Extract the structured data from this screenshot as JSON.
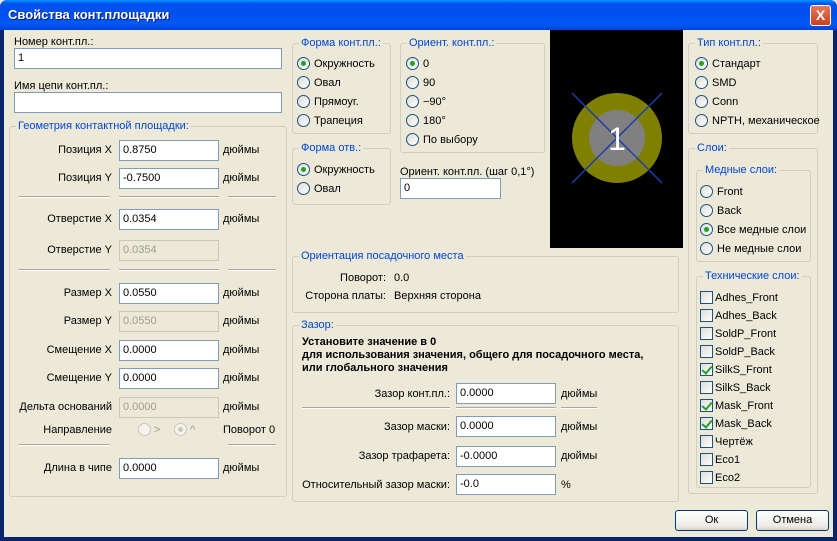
{
  "window": {
    "title": "Свойства конт.площадки",
    "close_label": "X"
  },
  "pad_number": {
    "label": "Номер конт.пл.:",
    "value": "1"
  },
  "net_name": {
    "label": "Имя цепи конт.пл.:",
    "value": ""
  },
  "geometry": {
    "title": "Геометрия контактной площадки:",
    "unit": "дюймы",
    "rows": [
      {
        "label": "Позиция X",
        "value": "0.8750",
        "disabled": false,
        "unit": true
      },
      {
        "label": "Позиция Y",
        "value": "-0.7500",
        "disabled": false,
        "unit": true
      },
      {
        "label": "Отверстие X",
        "value": "0.0354",
        "disabled": false,
        "unit": true
      },
      {
        "label": "Отверстие Y",
        "value": "0.0354",
        "disabled": true,
        "unit": false
      },
      {
        "label": "Размер X",
        "value": "0.0550",
        "disabled": false,
        "unit": true
      },
      {
        "label": "Размер Y",
        "value": "0.0550",
        "disabled": true,
        "unit": true
      },
      {
        "label": "Смещение X",
        "value": "0.0000",
        "disabled": false,
        "unit": true
      },
      {
        "label": "Смещение Y",
        "value": "0.0000",
        "disabled": false,
        "unit": true
      },
      {
        "label": "Дельта оснований",
        "value": "0.0000",
        "disabled": true,
        "unit": true
      }
    ],
    "direction": {
      "label": "Направление",
      "opt1": ">",
      "opt2": "^",
      "rotation_label": "Поворот 0"
    },
    "die_length": {
      "label": "Длина в чипе",
      "value": "0.0000"
    }
  },
  "pad_shape": {
    "title": "Форма конт.пл.:",
    "options": [
      "Окружность",
      "Овал",
      "Прямоуг.",
      "Трапеция"
    ],
    "selected": 0
  },
  "hole_shape": {
    "title": "Форма отв.:",
    "options": [
      "Окружность",
      "Овал"
    ],
    "selected": 0
  },
  "pad_orient": {
    "title": "Ориент. конт.пл.:",
    "options": [
      "0",
      "90",
      "−90°",
      "180°",
      "По выбору"
    ],
    "selected": 0,
    "custom_label": "Ориент. конт.пл. (шаг 0,1°)",
    "custom_value": "0"
  },
  "preview": {
    "pad_label": "1",
    "colors": {
      "background": "#000000",
      "copper": "#808000",
      "hole": "#808080",
      "cross": "#1e3caa"
    }
  },
  "pad_type": {
    "title": "Тип конт.пл.:",
    "options": [
      "Стандарт",
      "SMD",
      "Conn",
      "NPTH, механическое"
    ],
    "selected": 0
  },
  "layers": {
    "title": "Слои:",
    "copper_title": "Медные слои:",
    "copper_options": [
      "Front",
      "Back",
      "Все медные слои",
      "Не медные слои"
    ],
    "copper_selected": 2,
    "tech_title": "Технические слои:",
    "tech_items": [
      {
        "label": "Adhes_Front",
        "checked": false
      },
      {
        "label": "Adhes_Back",
        "checked": false
      },
      {
        "label": "SoldP_Front",
        "checked": false
      },
      {
        "label": "SoldP_Back",
        "checked": false
      },
      {
        "label": "SilkS_Front",
        "checked": true
      },
      {
        "label": "SilkS_Back",
        "checked": false
      },
      {
        "label": "Mask_Front",
        "checked": true
      },
      {
        "label": "Mask_Back",
        "checked": true
      },
      {
        "label": "Чертёж",
        "checked": false
      },
      {
        "label": "Eco1",
        "checked": false
      },
      {
        "label": "Eco2",
        "checked": false
      }
    ]
  },
  "footprint_orient": {
    "title": "Ориентация посадочного места",
    "rotation_label": "Поворот:",
    "rotation_value": "0.0",
    "side_label": "Сторона платы:",
    "side_value": "Верхняя сторона"
  },
  "clearance": {
    "title": "Зазор:",
    "note_line1": "Установите значение в 0",
    "note_line2": "для использования значения, общего для посадочного места,",
    "note_line3": "или глобального значения",
    "pad_label": "Зазор конт.пл.:",
    "pad_value": "0.0000",
    "pad_unit": "дюймы",
    "mask_label": "Зазор маски:",
    "mask_value": "0.0000",
    "mask_unit": "дюймы",
    "paste_label": "Зазор трафарета:",
    "paste_value": "-0.0000",
    "paste_unit": "дюймы",
    "ratio_label": "Относительный зазор маски:",
    "ratio_value": "-0.0",
    "ratio_unit": "%"
  },
  "buttons": {
    "ok": "Ок",
    "cancel": "Отмена"
  }
}
